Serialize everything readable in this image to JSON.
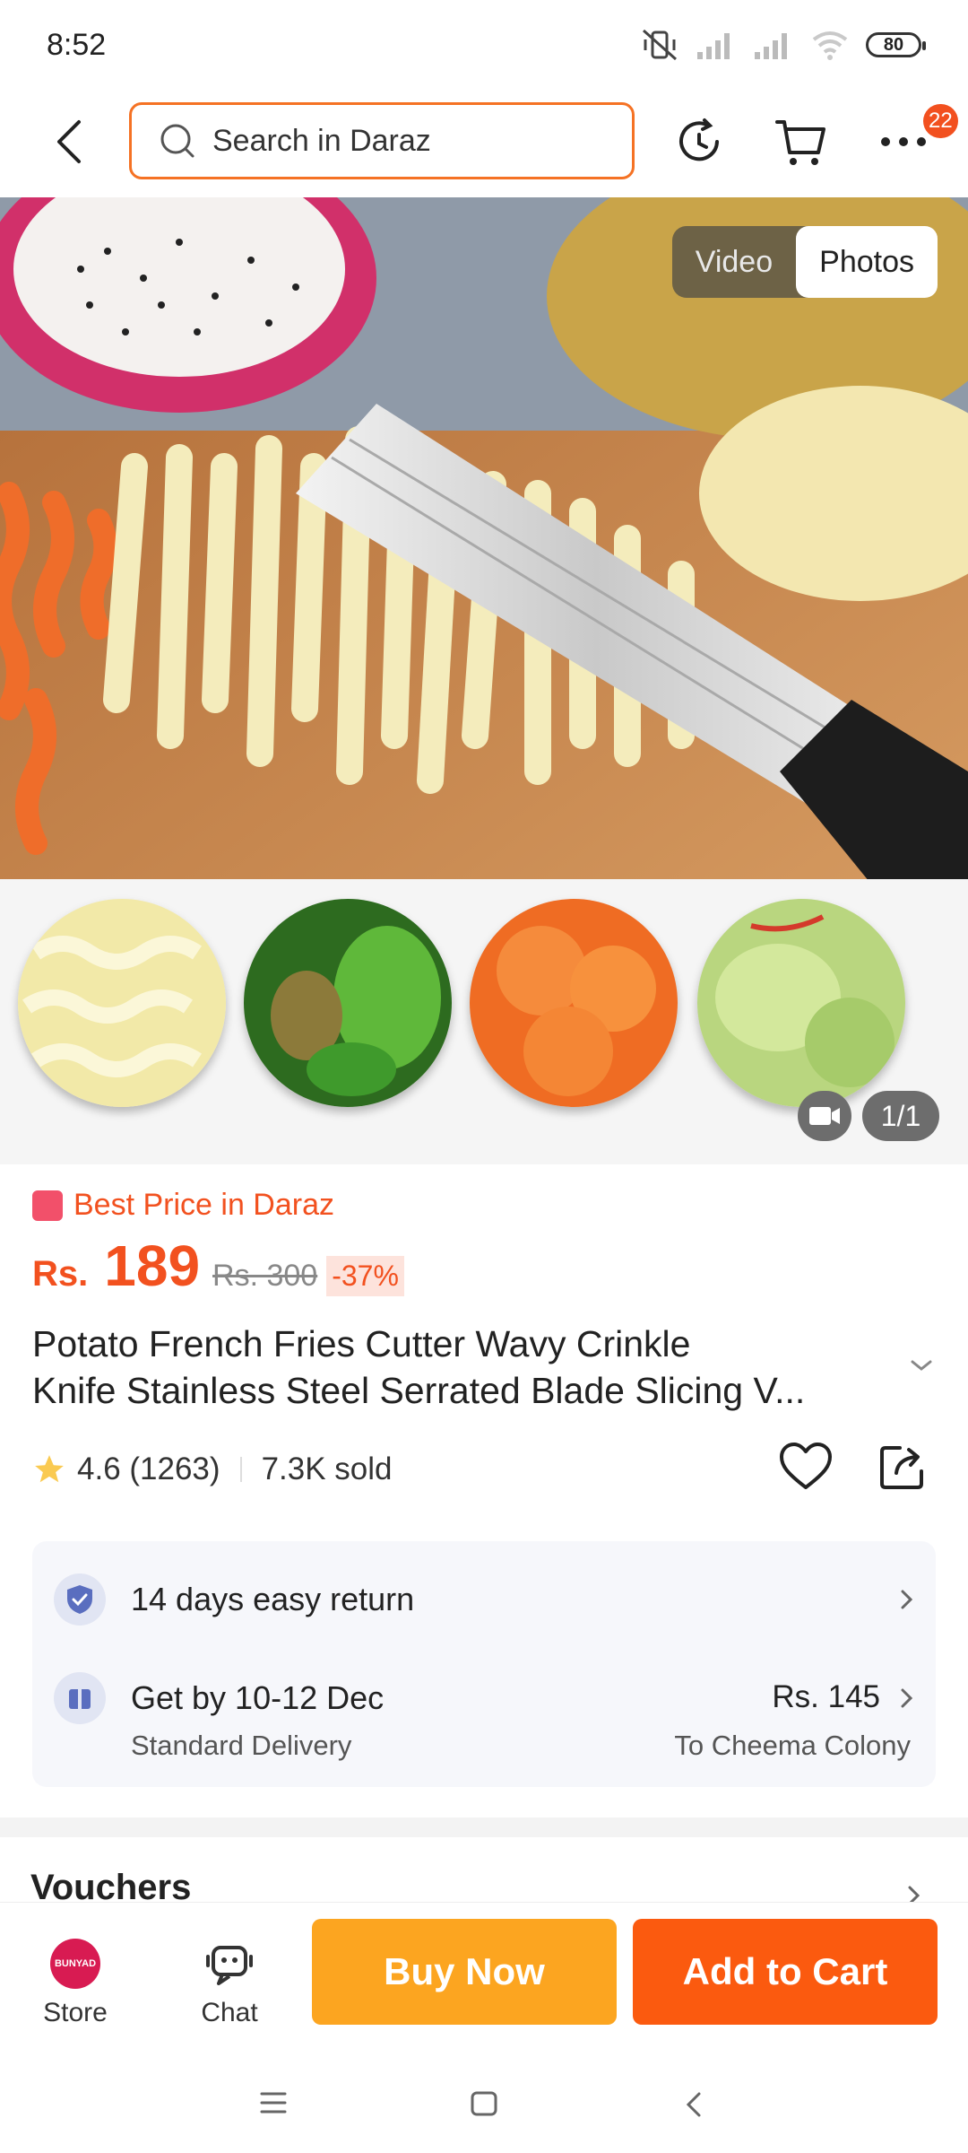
{
  "status_bar": {
    "time": "8:52",
    "battery": "80",
    "icons": [
      "mute-vibrate-icon",
      "signal-icon",
      "signal-icon",
      "wifi-icon",
      "battery-icon"
    ]
  },
  "header": {
    "search_placeholder": "Search in Daraz",
    "cart_badge": "22",
    "icons": [
      "back-arrow-icon",
      "search-icon",
      "history-icon",
      "cart-icon",
      "more-icon"
    ]
  },
  "media": {
    "toggle_video": "Video",
    "toggle_photos": "Photos",
    "thumb_count": "1/1",
    "thumbnails": [
      "crinkle-potato-slices",
      "green-vegetable-slices",
      "carrot-slices",
      "cucumber-slices"
    ]
  },
  "product": {
    "best_price_label": "Best Price in Daraz",
    "currency": "Rs.",
    "price": "189",
    "old_price": "Rs. 300",
    "discount": "-37%",
    "title_line1": "Potato French Fries Cutter Wavy Crinkle",
    "title_line2": "Knife Stainless Steel Serrated Blade Slicing V...",
    "rating": "4.6 (1263)",
    "sold": "7.3K sold"
  },
  "info": {
    "return_text": "14 days easy return",
    "delivery_main": "Get by 10-12 Dec",
    "delivery_sub": "Standard Delivery",
    "delivery_fee": "Rs. 145",
    "delivery_location": "To Cheema Colony"
  },
  "vouchers": {
    "label": "Vouchers"
  },
  "bottom_bar": {
    "store_label": "Store",
    "store_logo_text": "BUNYAD",
    "chat_label": "Chat",
    "buy_now": "Buy Now",
    "add_to_cart": "Add to Cart"
  },
  "colors": {
    "accent": "#f57224",
    "price": "#f2511f",
    "buy_now": "#fca520",
    "add_to_cart": "#fb5a0f"
  }
}
